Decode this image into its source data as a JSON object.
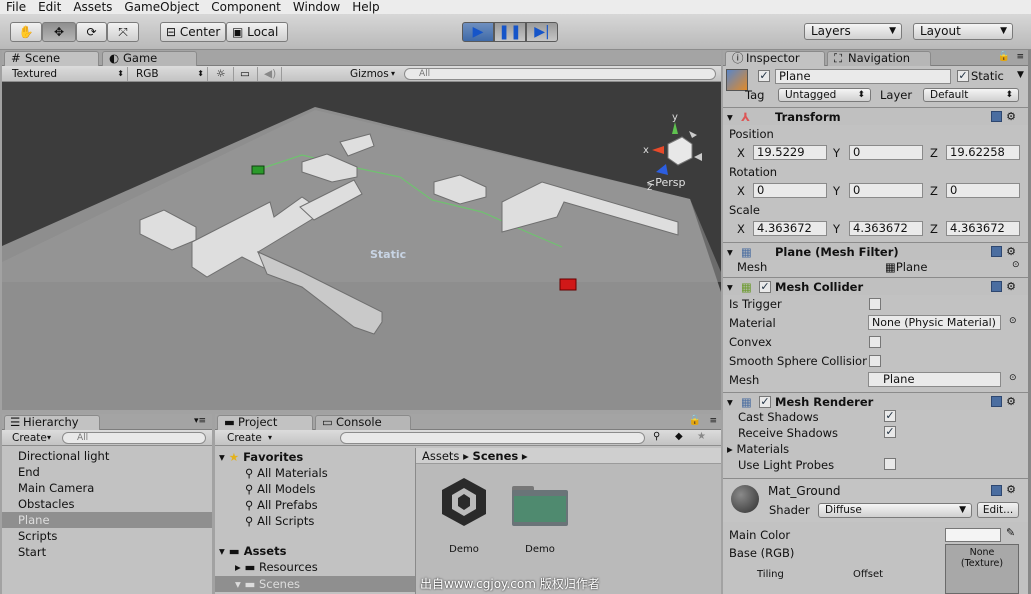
{
  "menu": [
    "File",
    "Edit",
    "Assets",
    "GameObject",
    "Component",
    "Window",
    "Help"
  ],
  "toolbar": {
    "pivot_label": "Center",
    "space_label": "Local",
    "layers_label": "Layers",
    "layout_label": "Layout"
  },
  "scene": {
    "tab_scene": "Scene",
    "tab_game": "Game",
    "draw_mode": "Textured",
    "render_mode": "RGB",
    "gizmos": "Gizmos",
    "search_placeholder": "All",
    "persp_label": "Persp",
    "static_label": "Static",
    "gizmo_axes": [
      "y",
      "x",
      "z"
    ]
  },
  "hierarchy": {
    "tab": "Hierarchy",
    "create": "Create",
    "search_placeholder": "All",
    "items": [
      "Directional light",
      "End",
      "Main Camera",
      "Obstacles",
      "Plane",
      "Scripts",
      "Start"
    ],
    "selected_index": 4
  },
  "project": {
    "tab_project": "Project",
    "tab_console": "Console",
    "create": "Create",
    "favorites_label": "Favorites",
    "favorites": [
      "All Materials",
      "All Models",
      "All Prefabs",
      "All Scripts"
    ],
    "assets_label": "Assets",
    "asset_folders": [
      "Resources",
      "Scenes"
    ],
    "breadcrumb_root": "Assets",
    "breadcrumb_current": "Scenes",
    "grid_items": [
      "Demo",
      "Demo"
    ]
  },
  "watermark": "出自www.cgjoy.com 版权归作者",
  "inspector": {
    "tab_inspector": "Inspector",
    "tab_navigation": "Navigation",
    "object_name": "Plane",
    "static_label": "Static",
    "tag_label": "Tag",
    "tag_value": "Untagged",
    "layer_label": "Layer",
    "layer_value": "Default",
    "transform": {
      "title": "Transform",
      "position_label": "Position",
      "position": {
        "x": "19.5229",
        "y": "0",
        "z": "19.62258"
      },
      "rotation_label": "Rotation",
      "rotation": {
        "x": "0",
        "y": "0",
        "z": "0"
      },
      "scale_label": "Scale",
      "scale": {
        "x": "4.363672",
        "y": "4.363672",
        "z": "4.363672"
      },
      "axis_x": "X",
      "axis_y": "Y",
      "axis_z": "Z"
    },
    "mesh_filter": {
      "title": "Plane (Mesh Filter)",
      "mesh_label": "Mesh",
      "mesh_value": "Plane"
    },
    "mesh_collider": {
      "title": "Mesh Collider",
      "is_trigger_label": "Is Trigger",
      "material_label": "Material",
      "material_value": "None (Physic Material)",
      "convex_label": "Convex",
      "smooth_label": "Smooth Sphere Collision",
      "mesh_label": "Mesh",
      "mesh_value": "Plane"
    },
    "mesh_renderer": {
      "title": "Mesh Renderer",
      "cast_shadows_label": "Cast Shadows",
      "cast_shadows": true,
      "receive_shadows_label": "Receive Shadows",
      "receive_shadows": true,
      "materials_label": "Materials",
      "use_light_probes_label": "Use Light Probes",
      "use_light_probes": false
    },
    "material": {
      "name": "Mat_Ground",
      "shader_label": "Shader",
      "shader_value": "Diffuse",
      "edit_label": "Edit...",
      "main_color_label": "Main Color",
      "base_label": "Base (RGB)",
      "texture_none": "None\n(Texture)",
      "tiling_label": "Tiling",
      "offset_label": "Offset"
    }
  },
  "colors": {
    "accent": "#3f6aa8",
    "path_green": "#6fc26f",
    "start_green": "#2a9a2a",
    "end_red": "#d01818"
  }
}
